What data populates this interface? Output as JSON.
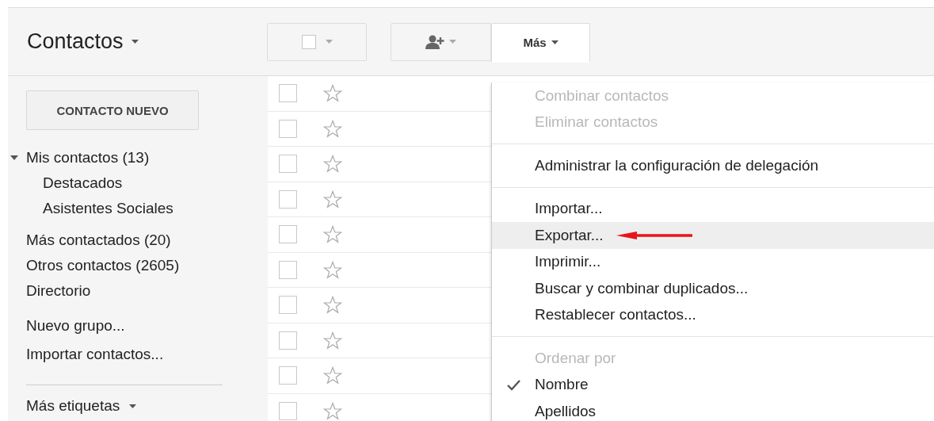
{
  "header": {
    "title": "Contactos"
  },
  "toolbar": {
    "select": {
      "checked": false
    },
    "more_button": {
      "label": "Más",
      "open": true
    }
  },
  "sidebar": {
    "new_contact_button": "CONTACTO NUEVO",
    "groups": [
      {
        "label": "Mis contactos (13)",
        "expanded": true,
        "children": [
          {
            "label": "Destacados"
          },
          {
            "label": "Asistentes Sociales"
          }
        ]
      },
      {
        "label": "Más contactados (20)"
      },
      {
        "label": "Otros contactos (2605)"
      },
      {
        "label": "Directorio"
      }
    ],
    "actions": [
      "Nuevo grupo...",
      "Importar contactos..."
    ],
    "more_labels": "Más etiquetas"
  },
  "contacts": [
    {
      "checked": false,
      "starred": false
    },
    {
      "checked": false,
      "starred": false
    },
    {
      "checked": false,
      "starred": false
    },
    {
      "checked": false,
      "starred": false
    },
    {
      "checked": false,
      "starred": false
    },
    {
      "checked": false,
      "starred": false
    },
    {
      "checked": false,
      "starred": false
    },
    {
      "checked": false,
      "starred": false
    },
    {
      "checked": false,
      "starred": false
    },
    {
      "checked": false,
      "starred": false
    }
  ],
  "menu": [
    {
      "kind": "item",
      "label": "Combinar contactos",
      "disabled": true,
      "highlighted": false,
      "checked": false
    },
    {
      "kind": "item",
      "label": "Eliminar contactos",
      "disabled": true,
      "highlighted": false,
      "checked": false
    },
    {
      "kind": "divider"
    },
    {
      "kind": "item",
      "label": "Administrar la configuración de delegación",
      "disabled": false,
      "highlighted": false,
      "checked": false
    },
    {
      "kind": "divider"
    },
    {
      "kind": "item",
      "label": "Importar...",
      "disabled": false,
      "highlighted": false,
      "checked": false
    },
    {
      "kind": "item",
      "label": "Exportar...",
      "disabled": false,
      "highlighted": true,
      "checked": false,
      "pointer_arrow": true
    },
    {
      "kind": "item",
      "label": "Imprimir...",
      "disabled": false,
      "highlighted": false,
      "checked": false
    },
    {
      "kind": "item",
      "label": "Buscar y combinar duplicados...",
      "disabled": false,
      "highlighted": false,
      "checked": false
    },
    {
      "kind": "item",
      "label": "Restablecer contactos...",
      "disabled": false,
      "highlighted": false,
      "checked": false
    },
    {
      "kind": "divider"
    },
    {
      "kind": "header",
      "label": "Ordenar por"
    },
    {
      "kind": "item",
      "label": "Nombre",
      "disabled": false,
      "highlighted": false,
      "checked": true
    },
    {
      "kind": "item",
      "label": "Apellidos",
      "disabled": false,
      "highlighted": false,
      "checked": false
    }
  ]
}
